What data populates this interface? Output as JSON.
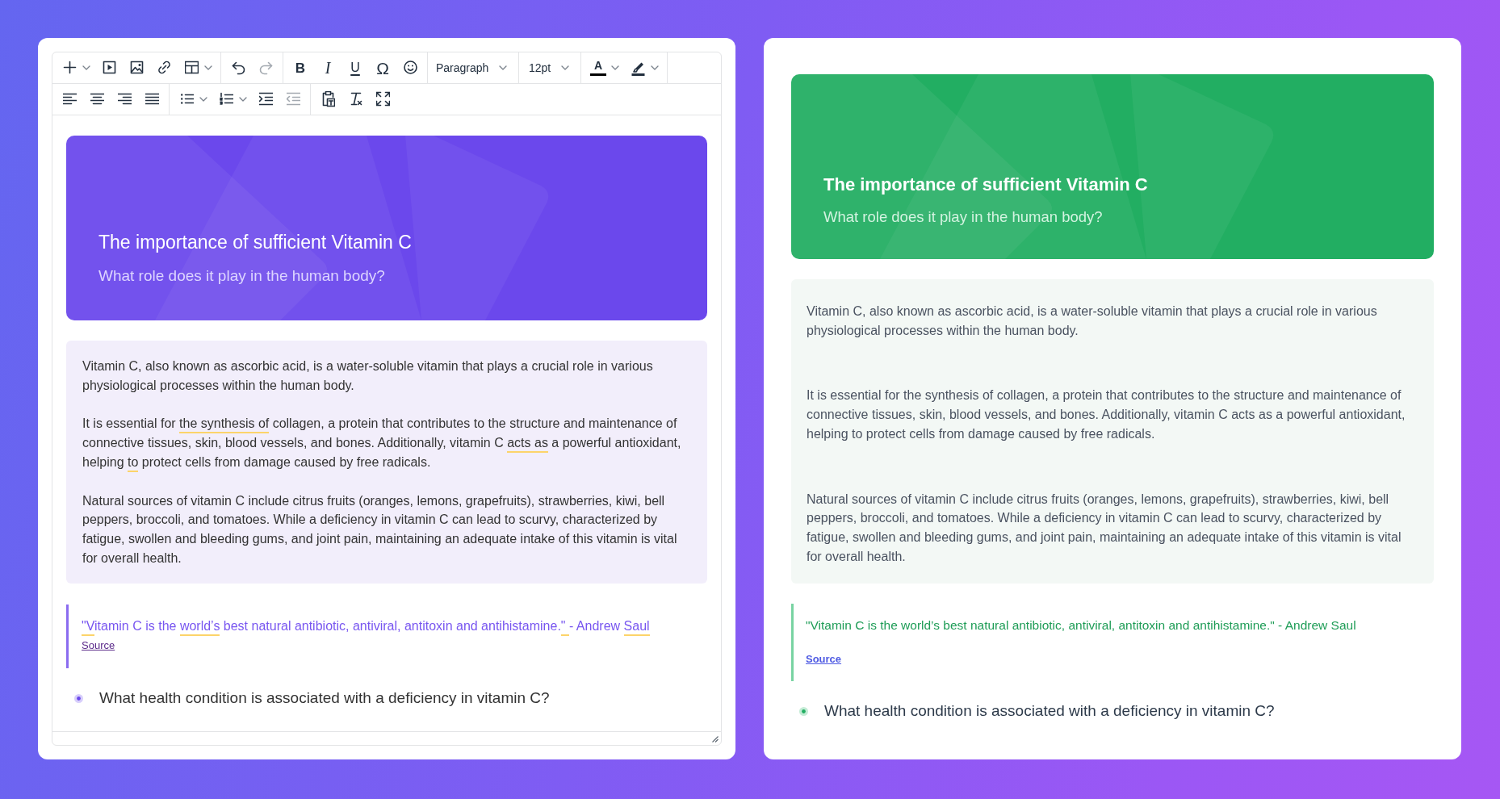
{
  "editor": {
    "toolbar": [
      [
        [
          {
            "kind": "plus",
            "menu": true,
            "disabled": false
          },
          {
            "kind": "media",
            "menu": false,
            "disabled": false
          },
          {
            "kind": "image",
            "menu": false,
            "disabled": false
          },
          {
            "kind": "link",
            "menu": false,
            "disabled": false
          },
          {
            "kind": "table",
            "menu": true,
            "disabled": false
          }
        ],
        [
          {
            "kind": "undo",
            "menu": false,
            "disabled": false
          },
          {
            "kind": "redo",
            "menu": false,
            "disabled": true
          }
        ],
        [
          {
            "kind": "bold",
            "label": "B",
            "menu": false,
            "disabled": false
          },
          {
            "kind": "italic",
            "label": "I",
            "menu": false,
            "disabled": false
          },
          {
            "kind": "underline",
            "label": "U",
            "menu": false,
            "disabled": false
          },
          {
            "kind": "glyph",
            "label": "Ω",
            "menu": false,
            "disabled": false
          },
          {
            "kind": "emoji",
            "menu": false,
            "disabled": false
          }
        ],
        [
          {
            "kind": "blocks",
            "label": "Paragraph",
            "menu": true,
            "disabled": false
          }
        ],
        [
          {
            "kind": "fontsize",
            "label": "12pt",
            "menu": true,
            "disabled": false
          }
        ],
        [
          {
            "kind": "textcolor",
            "label": "A",
            "menu": true,
            "disabled": false
          },
          {
            "kind": "highlight",
            "menu": true,
            "disabled": false
          }
        ]
      ],
      [
        [
          {
            "kind": "alignleft",
            "menu": false,
            "disabled": false
          },
          {
            "kind": "aligncenter",
            "menu": false,
            "disabled": false
          },
          {
            "kind": "alignright",
            "menu": false,
            "disabled": false
          },
          {
            "kind": "justify",
            "menu": false,
            "disabled": false
          }
        ],
        [
          {
            "kind": "bullist",
            "menu": true,
            "disabled": false
          },
          {
            "kind": "numlist",
            "menu": true,
            "disabled": false
          },
          {
            "kind": "indent",
            "menu": false,
            "disabled": false
          },
          {
            "kind": "outdent",
            "menu": false,
            "disabled": true
          }
        ],
        [
          {
            "kind": "pastetext",
            "menu": false,
            "disabled": false
          },
          {
            "kind": "clearformat",
            "menu": false,
            "disabled": false
          },
          {
            "kind": "fullscreen",
            "menu": false,
            "disabled": false
          }
        ]
      ]
    ],
    "content": {
      "hero": {
        "title": "The importance of sufficient Vitamin C",
        "subtitle": "What role does it play in the human body?"
      },
      "paragraphs": [
        [
          {
            "text": "Vitamin C, also known as ascorbic acid, is a water-soluble vitamin that plays a crucial role in various physiological processes within the human body.",
            "flagged": false
          }
        ],
        [
          {
            "text": "It is essential for ",
            "flagged": false
          },
          {
            "text": "the synthesis of",
            "flagged": true
          },
          {
            "text": " collagen, a protein that contributes to the structure and maintenance of connective tissues, skin, blood vessels, and bones. Additionally, vitamin C ",
            "flagged": false
          },
          {
            "text": "acts as",
            "flagged": true
          },
          {
            "text": " a powerful antioxidant, helping ",
            "flagged": false
          },
          {
            "text": "to",
            "flagged": true
          },
          {
            "text": " protect cells from damage caused by free radicals.",
            "flagged": false
          }
        ],
        [
          {
            "text": "Natural sources of vitamin C include citrus fruits (oranges, lemons, grapefruits), strawberries, kiwi, bell peppers, broccoli, and tomatoes. While a deficiency in vitamin C can lead to scurvy, characterized by fatigue, swollen and bleeding gums, and joint pain, maintaining an adequate intake of this vitamin is vital for overall health.",
            "flagged": false
          }
        ]
      ],
      "quote": {
        "segments": [
          {
            "text": "\"V",
            "flagged": true
          },
          {
            "text": "itamin C is the ",
            "flagged": false
          },
          {
            "text": "world’s",
            "flagged": true
          },
          {
            "text": " best natural antibiotic, antiviral, antitoxin and antihistamine.",
            "flagged": false
          },
          {
            "text": "\" ",
            "flagged": true
          },
          {
            "text": "- Andrew ",
            "flagged": false
          },
          {
            "text": "Saul",
            "flagged": true
          }
        ],
        "source": "Source"
      },
      "question": "What health condition is associated with a deficiency in vitamin C?"
    }
  },
  "preview": {
    "hero": {
      "title": "The importance of sufficient Vitamin C",
      "subtitle": "What role does it play in the human body?"
    },
    "paragraphs": [
      "Vitamin C, also known as ascorbic acid, is a water-soluble vitamin that plays a crucial role in various physiological processes within the human body.",
      "It is essential for the synthesis of collagen, a protein that contributes to the structure and maintenance of connective tissues, skin, blood vessels, and bones. Additionally, vitamin C acts as a powerful antioxidant, helping to protect cells from damage caused by free radicals.",
      "Natural sources of vitamin C include citrus fruits (oranges, lemons, grapefruits), strawberries, kiwi, bell peppers, broccoli, and tomatoes. While a deficiency in vitamin C can lead to scurvy, characterized by fatigue, swollen and bleeding gums, and joint pain, maintaining an adequate intake of this vitamin is vital for overall health."
    ],
    "quote": {
      "text": "\"Vitamin C is the world’s best natural antibiotic, antiviral, antitoxin and antihistamine.\" - Andrew Saul",
      "source": "Source"
    },
    "question": "What health condition is associated with a deficiency in vitamin C?"
  }
}
